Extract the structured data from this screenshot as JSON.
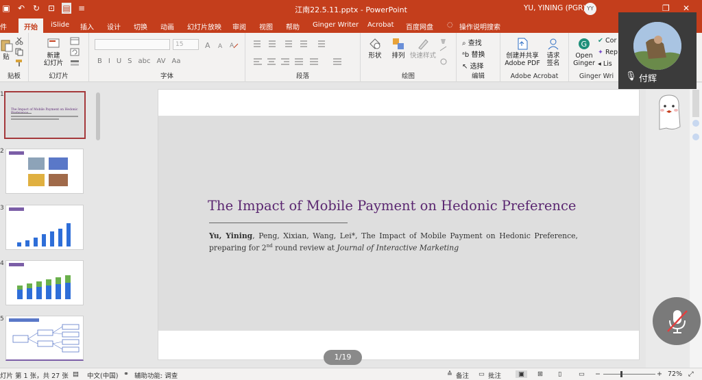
{
  "window": {
    "title": "江南22.5.11.pptx  -  PowerPoint",
    "user_name": "YU, YINING (PGR)",
    "user_initials": "YY"
  },
  "tabs": [
    "件",
    "开始",
    "iSlide",
    "插入",
    "设计",
    "切换",
    "动画",
    "幻灯片放映",
    "审阅",
    "视图",
    "帮助",
    "Ginger Writer",
    "Acrobat",
    "百度网盘",
    "操作说明搜索"
  ],
  "ribbon": {
    "clipboard": {
      "paste": "贴",
      "label": "贴板"
    },
    "slides": {
      "new_slide_line1": "新建",
      "new_slide_line2": "幻灯片",
      "label": "幻灯片"
    },
    "font": {
      "size_value": "15",
      "format_buttons": [
        "B",
        "I",
        "U",
        "S",
        "abc",
        "AV",
        "Aa"
      ],
      "label": "字体"
    },
    "paragraph": {
      "label": "段落"
    },
    "drawing": {
      "shape": "形状",
      "arrange": "排列",
      "quick_styles": "快速样式",
      "label": "绘图"
    },
    "editing": {
      "find": "查找",
      "replace": "替换",
      "select": "选择",
      "label": "编辑"
    },
    "acrobat": {
      "create_line1": "创建并共享",
      "create_line2": "Adobe PDF",
      "request_line1": "请求",
      "request_line2": "签名",
      "label": "Adobe Acrobat"
    },
    "ginger": {
      "open_line1": "Open",
      "open_line2": "Ginger",
      "cor": "Cor",
      "rep": "Rep",
      "lis": "Lis",
      "label": "Ginger Wri"
    }
  },
  "thumbnails": {
    "numbers": [
      "1",
      "2",
      "3",
      "4",
      "5"
    ],
    "slide1_title": "The Impact of Mobile Payment on Hedonic Preference"
  },
  "slide": {
    "title": "The Impact of Mobile Payment on Hedonic Preference",
    "ref_authors_bold": "Yu, Yining",
    "ref_authors_rest": ", Peng, Xixian, Wang, Lei*, The Impact of Mobile Payment on Hedonic Preference, preparing for 2",
    "ref_sup": "nd",
    "ref_mid": " round review at ",
    "ref_journal": "Journal of Interactive Marketing"
  },
  "page_indicator": "1/19",
  "video": {
    "participant_name": "付辉"
  },
  "status": {
    "slide_info": "灯片 第 1 张，共 27 张",
    "language": "中文(中国)",
    "accessibility": "辅助功能: 调查",
    "notes": "备注",
    "comments": "批注",
    "zoom": "72%"
  },
  "colors": {
    "accent": "#c43e1c",
    "slide_title": "#5a2670",
    "selected_thumb": "#a4373a"
  }
}
